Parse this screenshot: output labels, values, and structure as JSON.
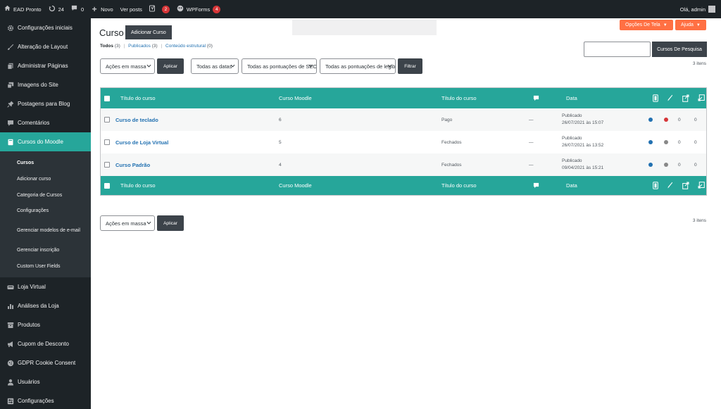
{
  "adminbar": {
    "site_name": "EAD Pronto",
    "updates_count": "24",
    "comments_count": "0",
    "new_label": "Novo",
    "view_posts_label": "Ver posts",
    "yoast_badge": "2",
    "wpforms_label": "WPForms",
    "wpforms_badge": "4",
    "greeting": "Olá, admin"
  },
  "sidebar": {
    "items": [
      {
        "label": "Configurações iniciais",
        "icon": "gear-icon"
      },
      {
        "label": "Alteração de Layout",
        "icon": "brush-icon"
      },
      {
        "label": "Administrar Páginas",
        "icon": "pages-icon"
      },
      {
        "label": "Imagens do Site",
        "icon": "media-icon"
      },
      {
        "label": "Postagens para Blog",
        "icon": "pin-icon"
      },
      {
        "label": "Comentários",
        "icon": "comment-icon"
      },
      {
        "label": "Cursos do Moodle",
        "icon": "book-icon"
      }
    ],
    "submenu": [
      "Cursos",
      "Adicionar curso",
      "Categoria de Cursos",
      "Configurações",
      "Gerenciar modelos de e-mail",
      "Gerenciar inscrição",
      "Custom User Fields"
    ],
    "items_after": [
      {
        "label": "Loja Virtual",
        "icon": "store-icon"
      },
      {
        "label": "Análises da Loja",
        "icon": "chart-icon"
      },
      {
        "label": "Produtos",
        "icon": "archive-icon"
      },
      {
        "label": "Cupom de Desconto",
        "icon": "megaphone-icon"
      },
      {
        "label": "GDPR Cookie Consent",
        "icon": "cookie-icon"
      },
      {
        "label": "Usuários",
        "icon": "user-icon"
      },
      {
        "label": "Configurações",
        "icon": "settings-icon"
      }
    ]
  },
  "main": {
    "screen_options": "Opções De Tela",
    "help": "Ajuda",
    "page_title": "Curso",
    "add_button": "Adicionar Curso",
    "views": {
      "all_label": "Todos",
      "all_count": "(3)",
      "published_label": "Publicados",
      "published_count": "(3)",
      "structural_label": "Conteúdo estrutural",
      "structural_count": "(0)"
    },
    "search_button": "Cursos De Pesquisa",
    "items_count": "3 itens",
    "bulk_actions": "Ações em massa",
    "apply": "Aplicar",
    "all_dates": "Todas as datas",
    "seo_scores": "Todas as pontuações de SEO",
    "readability_scores": "Todas as pontuações de legibilidade",
    "filter": "Filtrar"
  },
  "table": {
    "columns": {
      "title": "Título do curso",
      "moodle": "Curso Moodle",
      "price_title": "Título do curso",
      "date": "Data"
    },
    "rows": [
      {
        "title": "Curso de teclado",
        "moodle": "6",
        "price": "Pago",
        "comments": "—",
        "status": "Publicado",
        "date": "26/07/2021 às 15:07",
        "seo_color": "#2271b1",
        "read_color": "#d63638",
        "links_out": "0",
        "links_in": "0"
      },
      {
        "title": "Curso de Loja Virtual",
        "moodle": "5",
        "price": "Fechados",
        "comments": "—",
        "status": "Publicado",
        "date": "26/07/2021 às 13:52",
        "seo_color": "#2271b1",
        "read_color": "#888888",
        "links_out": "0",
        "links_in": "0"
      },
      {
        "title": "Curso Padrão",
        "moodle": "4",
        "price": "Fechados",
        "comments": "—",
        "status": "Publicado",
        "date": "09/04/2021 às 15:21",
        "seo_color": "#2271b1",
        "read_color": "#888888",
        "links_out": "0",
        "links_in": "0"
      }
    ]
  },
  "colors": {
    "accent": "#26a69a",
    "sidebar_bg": "#1d2327",
    "orange": "#ff7043",
    "link": "#2271b1"
  }
}
